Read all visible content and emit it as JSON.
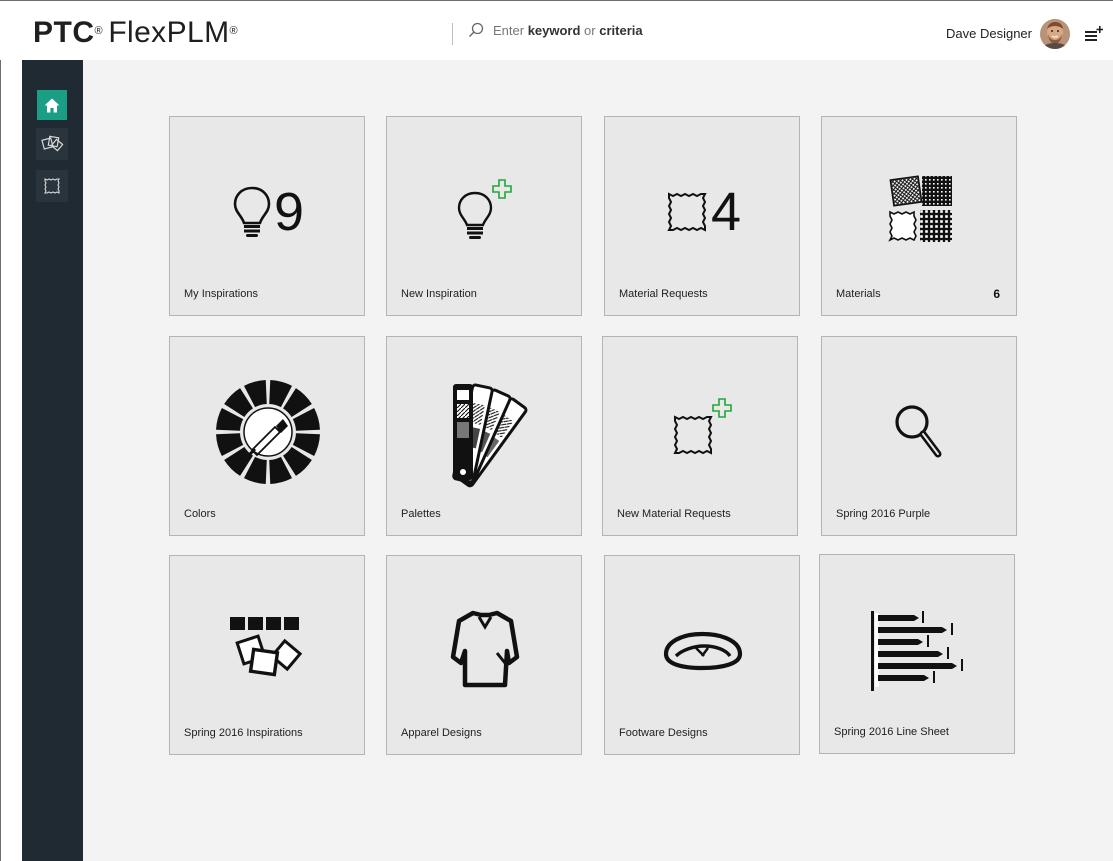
{
  "header": {
    "brand": "PTC",
    "product": "FlexPLM",
    "registered_mark": "®",
    "search": {
      "placeholder": "Enter keyword or criteria",
      "hint_prefix": "Enter ",
      "hint_keyword": "keyword",
      "hint_middle": " or ",
      "hint_criteria": "criteria"
    },
    "user_name": "Dave Designer"
  },
  "sidebar": {
    "items": [
      {
        "name": "home",
        "icon": "home-icon",
        "active": true
      },
      {
        "name": "inspirations",
        "icon": "photos-icon",
        "active": false
      },
      {
        "name": "materials",
        "icon": "swatch-icon",
        "active": false
      }
    ]
  },
  "tiles": [
    {
      "label": "My Inspirations",
      "icon": "lightbulb-icon",
      "big_count": "9"
    },
    {
      "label": "New Inspiration",
      "icon": "lightbulb-add-icon"
    },
    {
      "label": "Material Requests",
      "icon": "swatch-icon",
      "big_count": "4"
    },
    {
      "label": "Materials",
      "icon": "fabrics-icon",
      "count": "6"
    },
    {
      "label": "Colors",
      "icon": "color-wheel-icon"
    },
    {
      "label": "Palettes",
      "icon": "palette-fan-icon"
    },
    {
      "label": "New Material Requests",
      "icon": "swatch-add-icon"
    },
    {
      "label": "Spring 2016 Purple",
      "icon": "magnifier-icon"
    },
    {
      "label": "Spring 2016 Inspirations",
      "icon": "photo-collection-icon"
    },
    {
      "label": "Apparel Designs",
      "icon": "sweater-icon"
    },
    {
      "label": "Footware Designs",
      "icon": "shoe-icon"
    },
    {
      "label": "Spring 2016 Line Sheet",
      "icon": "line-sheet-icon"
    }
  ],
  "colors": {
    "accent": "#1a9f86",
    "sidebar": "#1f2a33",
    "tile_bg": "#e8e8e8",
    "content_bg": "#f3f3f3",
    "add_plus": "#22a63a"
  }
}
